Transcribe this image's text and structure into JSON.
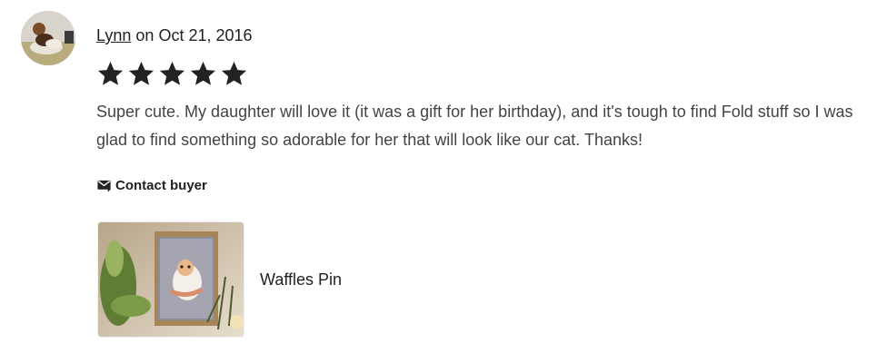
{
  "review": {
    "reviewer": "Lynn",
    "date_prefix": "on",
    "date": "Oct 21, 2016",
    "rating": 5,
    "max_rating": 5,
    "text": "Super cute. My daughter will love it (it was a gift for her birthday), and it's tough to find Fold stuff so I was glad to find something so adorable for her that will look like our cat. Thanks!",
    "contact_label": "Contact buyer",
    "item_title": "Waffles Pin"
  },
  "colors": {
    "star": "#222222",
    "text": "#444444"
  }
}
